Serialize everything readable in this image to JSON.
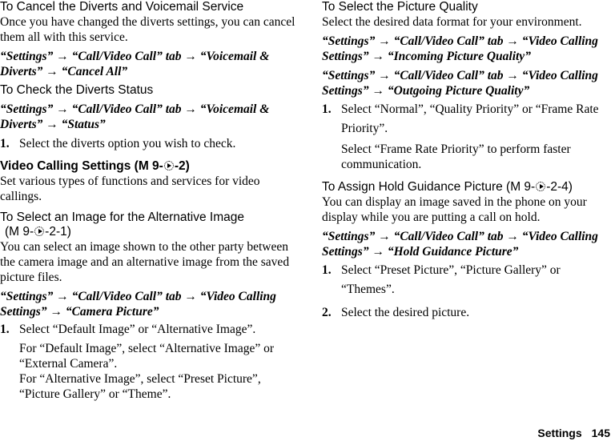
{
  "left": {
    "cancel": {
      "heading": "To Cancel the Diverts and Voicemail Service",
      "body": "Once you have changed the diverts settings, you can cancel them all with this service.",
      "path": "“Settings” → “Call/Video Call” tab → “Voicemail & Diverts” → “Cancel All”"
    },
    "check": {
      "heading": "To Check the Diverts Status",
      "path": "“Settings” → “Call/Video Call” tab → “Voicemail & Diverts” → “Status”",
      "steps": [
        {
          "num": "1.",
          "text": "Select the diverts option you wish to check."
        }
      ]
    },
    "video": {
      "heading": "Video Calling Settings",
      "ref_prefix": "(M 9-",
      "ref_suffix": "-2)",
      "body": "Set various types of functions and services for video callings."
    },
    "alt_image": {
      "heading": "To Select an Image for the Alternative Image",
      "ref_prefix": "(M 9-",
      "ref_suffix": "-2-1)",
      "body": "You can select an image shown to the other party between the camera image and an alternative image from the saved picture files.",
      "path": "“Settings” → “Call/Video Call” tab → “Video Calling Settings” → “Camera Picture”",
      "steps": [
        {
          "num": "1.",
          "text": "Select “Default Image” or “Alternative Image”."
        }
      ],
      "note1": "For “Default Image”, select “Alternative Image” or “External Camera”.",
      "note2": "For “Alternative Image”, select “Preset Picture”, “Picture Gallery” or “Theme”."
    }
  },
  "right": {
    "quality": {
      "heading": "To Select the Picture Quality",
      "body": "Select the desired data format for your environment.",
      "path1": "“Settings” → “Call/Video Call” tab → “Video Calling Settings” → “Incoming Picture Quality”",
      "path2": "“Settings” → “Call/Video Call” tab → “Video Calling Settings” → “Outgoing Picture Quality”",
      "steps": [
        {
          "num": "1.",
          "text": "Select “Normal”, “Quality Priority” or “Frame Rate Priority”."
        }
      ],
      "note": "Select “Frame Rate Priority” to perform faster communication."
    },
    "hold": {
      "heading": "To Assign Hold Guidance Picture",
      "ref_prefix": "(M 9-",
      "ref_suffix": "-2-4)",
      "body": "You can display an image saved in the phone on your display while you are putting a call on hold.",
      "path": "“Settings” → “Call/Video Call” tab → “Video Calling Settings” → “Hold Guidance Picture”",
      "steps": [
        {
          "num": "1.",
          "text": "Select “Preset Picture”, “Picture Gallery” or “Themes”."
        },
        {
          "num": "2.",
          "text": "Select the desired picture."
        }
      ]
    }
  },
  "footer": {
    "section": "Settings",
    "page": "145"
  },
  "icons": {
    "menu": "menu-navigation-right-icon"
  }
}
